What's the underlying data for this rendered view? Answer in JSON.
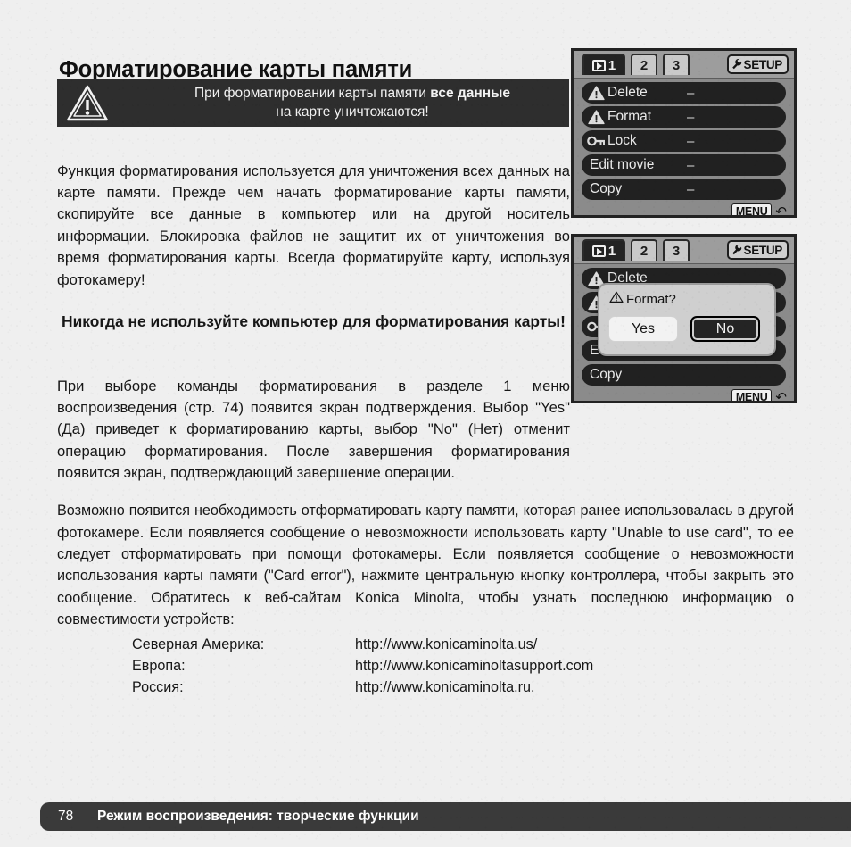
{
  "page": {
    "title": "Форматирование карты памяти",
    "background_color": "#efefef"
  },
  "warning_box": {
    "icon": "warning-triangle-icon",
    "line1_prefix": "При форматировании карты памяти ",
    "line1_bold": "все данные",
    "line2": "на карте уничтожаются!",
    "background_color": "#2e2e2e",
    "text_color": "#f2f2f2"
  },
  "paragraphs": {
    "p1": "Функция форматирования используется для уничтожения всех данных на карте памяти. Прежде чем начать форматирование карты памяти, скопируйте все данные в компьютер или на другой носитель информации. Блокировка файлов не защитит их от уничтожения во время форматирования карты. Всегда форматируйте карту, используя фотокамеру!",
    "p2_bold_heading": "Никогда не используйте компьютер для форматирования карты!",
    "p3": "При выборе команды форматирования в разделе 1 меню воспроизведения (стр. 74) появится экран подтверждения. Выбор \"Yes\" (Да) приведет к форматированию карты, выбор \"No\" (Нет) отменит операцию форматирования. После завершения форматирования появится экран, подтверждающий завершение операции.",
    "p4": "Возможно появится необходимость отформатировать карту памяти, которая ранее использовалась в другой фотокамере. Если появляется сообщение о невозможности использовать карту \"Unable to use card\", то ее следует отформатировать при помощи фотокамеры. Если появляется сообщение о невозможности использования карты памяти (\"Card error\"), нажмите центральную кнопку контроллера, чтобы закрыть это сообщение. Обратитесь к веб-сайтам Konica Minolta, чтобы узнать последнюю информацию о совместимости устройств:"
  },
  "url_table": {
    "rows": [
      {
        "region": "Северная Америка:",
        "url": "http://www.konicaminolta.us/"
      },
      {
        "region": "Европа:",
        "url": "http://www.konicaminoltasupport.com"
      },
      {
        "region": "Россия:",
        "url": "http://www.konicaminolta.ru."
      }
    ]
  },
  "lcd_menu": {
    "tabs": [
      {
        "label": "1",
        "icon": "playback-icon",
        "selected": true
      },
      {
        "label": "2",
        "icon": "",
        "selected": false
      },
      {
        "label": "3",
        "icon": "",
        "selected": false
      }
    ],
    "setup_button": {
      "label": "SETUP",
      "icon": "wrench-icon"
    },
    "rows": [
      {
        "label": "Delete",
        "icon": "warning-triangle-icon",
        "value": "–"
      },
      {
        "label": "Format",
        "icon": "warning-triangle-icon",
        "value": "–"
      },
      {
        "label": "Lock",
        "icon": "key-icon",
        "value": "–"
      },
      {
        "label": "Edit movie",
        "icon": "",
        "value": "–"
      },
      {
        "label": "Copy",
        "icon": "",
        "value": "–"
      }
    ],
    "menu_button": {
      "label": "MENU",
      "icon": "back-arrow-icon"
    }
  },
  "lcd_dialog": {
    "tabs": [
      {
        "label": "1",
        "icon": "playback-icon",
        "selected": true
      },
      {
        "label": "2",
        "icon": "",
        "selected": false
      },
      {
        "label": "3",
        "icon": "",
        "selected": false
      }
    ],
    "setup_button": {
      "label": "SETUP",
      "icon": "wrench-icon"
    },
    "background_rows": [
      {
        "label": "Delete",
        "icon": "warning-triangle-icon"
      },
      {
        "label": "",
        "icon": "warning-triangle-icon"
      },
      {
        "label": "",
        "icon": "key-icon"
      },
      {
        "label": "E",
        "icon": ""
      },
      {
        "label": "Copy",
        "icon": ""
      }
    ],
    "confirm": {
      "icon": "warning-triangle-icon",
      "title": "Format?",
      "yes_label": "Yes",
      "no_label": "No",
      "selected": "No"
    },
    "menu_button": {
      "label": "MENU",
      "icon": "back-arrow-icon"
    }
  },
  "footer": {
    "page_number": "78",
    "text": "Режим воспроизведения: творческие функции",
    "background_color": "#3a3a3a"
  }
}
